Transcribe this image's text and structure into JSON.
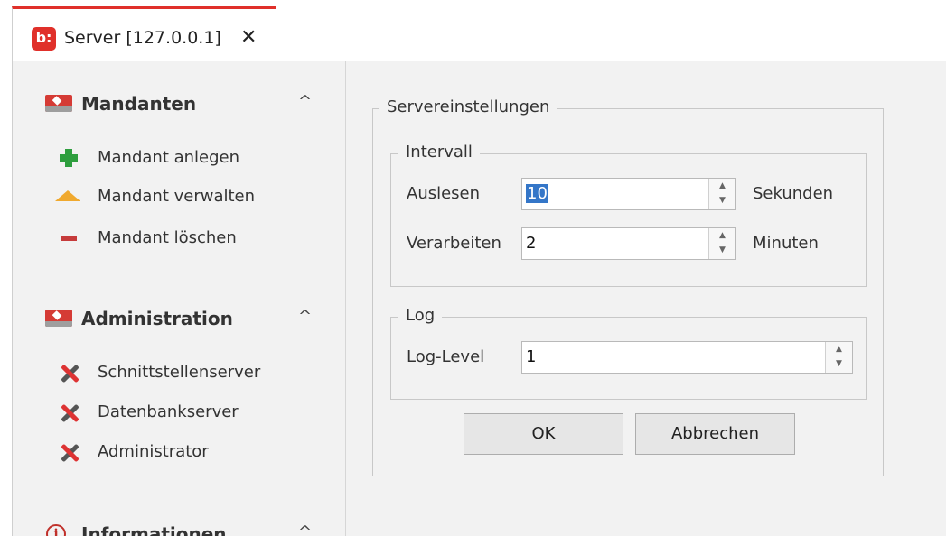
{
  "tab": {
    "logo_text": "b:",
    "title": "Server [127.0.0.1]",
    "close_glyph": "✕"
  },
  "sidebar": {
    "sections": [
      {
        "title": "Mandanten",
        "chevron": "^",
        "items": [
          {
            "label": "Mandant anlegen",
            "icon": "plus-icon"
          },
          {
            "label": "Mandant verwalten",
            "icon": "triangle-icon"
          },
          {
            "label": "Mandant löschen",
            "icon": "minus-icon"
          }
        ]
      },
      {
        "title": "Administration",
        "chevron": "^",
        "items": [
          {
            "label": "Schnittstellenserver",
            "icon": "tools-icon"
          },
          {
            "label": "Datenbankserver",
            "icon": "tools-icon"
          },
          {
            "label": "Administrator",
            "icon": "tools-icon"
          }
        ]
      },
      {
        "title": "Informationen",
        "chevron": "^",
        "icon_glyph": "i",
        "items": []
      }
    ]
  },
  "server_settings": {
    "caption": "Servereinstellungen",
    "interval": {
      "caption": "Intervall",
      "read": {
        "label": "Auslesen",
        "value": "10",
        "unit": "Sekunden"
      },
      "process": {
        "label": "Verarbeiten",
        "value": "2",
        "unit": "Minuten"
      }
    },
    "log": {
      "caption": "Log",
      "level": {
        "label": "Log-Level",
        "value": "1"
      }
    },
    "ok_label": "OK",
    "cancel_label": "Abbrechen"
  },
  "colors": {
    "accent": "#e0302a",
    "panel": "#f2f2f2",
    "selection": "#3476c8"
  }
}
